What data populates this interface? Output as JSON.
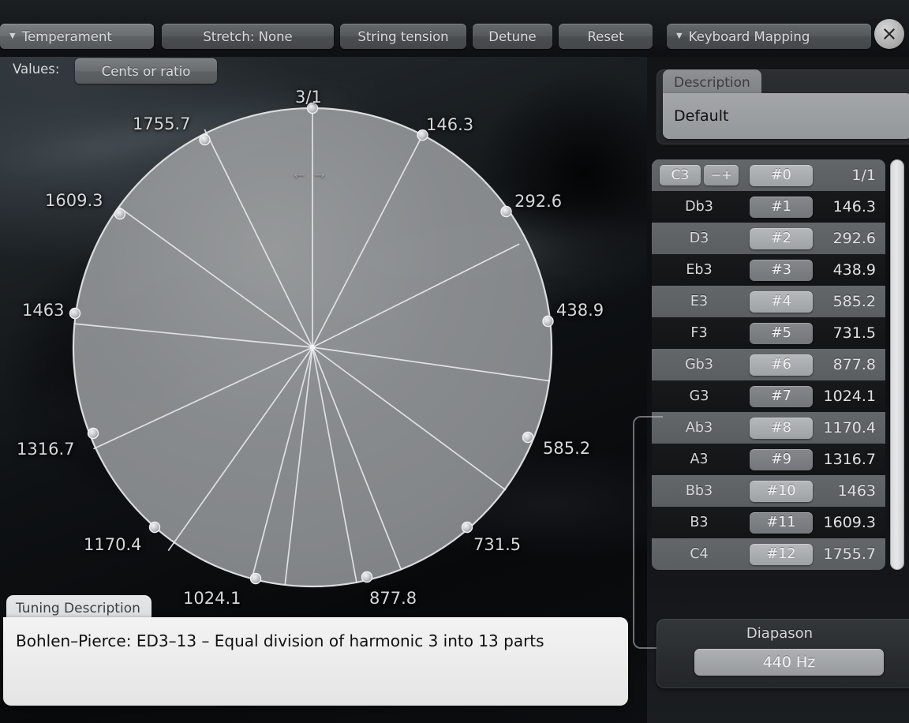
{
  "toolbar": {
    "temperament": {
      "label": "Temperament",
      "caret": "chevron-down-icon"
    },
    "stretch": {
      "label": "Stretch: None"
    },
    "string_tension": {
      "label": "String tension"
    },
    "detune": {
      "label": "Detune"
    },
    "reset": {
      "label": "Reset"
    },
    "keyboard_mapping": {
      "label": "Keyboard Mapping",
      "caret": "chevron-down-icon"
    },
    "close": {
      "icon": "close-icon"
    },
    "values_label": "Values:",
    "values_button": "Cents or ratio"
  },
  "wheel": {
    "top_label": "3/1",
    "drag_cursor": "← →",
    "labels": [
      "3/1",
      "146.3",
      "292.6",
      "438.9",
      "585.2",
      "731.5",
      "877.8",
      "1024.1",
      "1170.4",
      "1316.7",
      "1463",
      "1609.3",
      "1755.7"
    ]
  },
  "description": {
    "tab_label": "Description",
    "value": "Default"
  },
  "notes": {
    "rows": [
      {
        "note": "C3",
        "index": "#0",
        "value": "1/1",
        "pm": "− +"
      },
      {
        "note": "Db3",
        "index": "#1",
        "value": "146.3"
      },
      {
        "note": "D3",
        "index": "#2",
        "value": "292.6"
      },
      {
        "note": "Eb3",
        "index": "#3",
        "value": "438.9"
      },
      {
        "note": "E3",
        "index": "#4",
        "value": "585.2"
      },
      {
        "note": "F3",
        "index": "#5",
        "value": "731.5"
      },
      {
        "note": "Gb3",
        "index": "#6",
        "value": "877.8"
      },
      {
        "note": "G3",
        "index": "#7",
        "value": "1024.1"
      },
      {
        "note": "Ab3",
        "index": "#8",
        "value": "1170.4"
      },
      {
        "note": "A3",
        "index": "#9",
        "value": "1316.7"
      },
      {
        "note": "Bb3",
        "index": "#10",
        "value": "1463"
      },
      {
        "note": "B3",
        "index": "#11",
        "value": "1609.3"
      },
      {
        "note": "C4",
        "index": "#12",
        "value": "1755.7"
      }
    ]
  },
  "diapason": {
    "title": "Diapason",
    "value": "440 Hz"
  },
  "tuning_description": {
    "tab_label": "Tuning Description",
    "text": "Bohlen–Pierce: ED3–13 – Equal division of harmonic 3 into 13 parts"
  },
  "chart_data": {
    "type": "pie",
    "title": "Bohlen-Pierce ED3-13 tuning wheel",
    "categories": [
      "3/1",
      "146.3",
      "292.6",
      "438.9",
      "585.2",
      "731.5",
      "877.8",
      "1024.1",
      "1170.4",
      "1316.7",
      "1463",
      "1609.3",
      "1755.7"
    ],
    "values": [
      0,
      146.3,
      292.6,
      438.9,
      585.2,
      731.5,
      877.8,
      1024.1,
      1170.4,
      1316.7,
      1463,
      1609.3,
      1755.7
    ],
    "unit": "cents",
    "period_cents": 1902,
    "divisions": 13,
    "legend": "none",
    "grid": false
  },
  "colors": {
    "panel_bg": "#0c0e10",
    "row_light": "#5e6265",
    "row_dark": "#141619",
    "pill": "#a5a8ab",
    "text": "#d6d8da",
    "wheel_fill": "#8e9193",
    "desc_bg": "#eeeeee"
  }
}
